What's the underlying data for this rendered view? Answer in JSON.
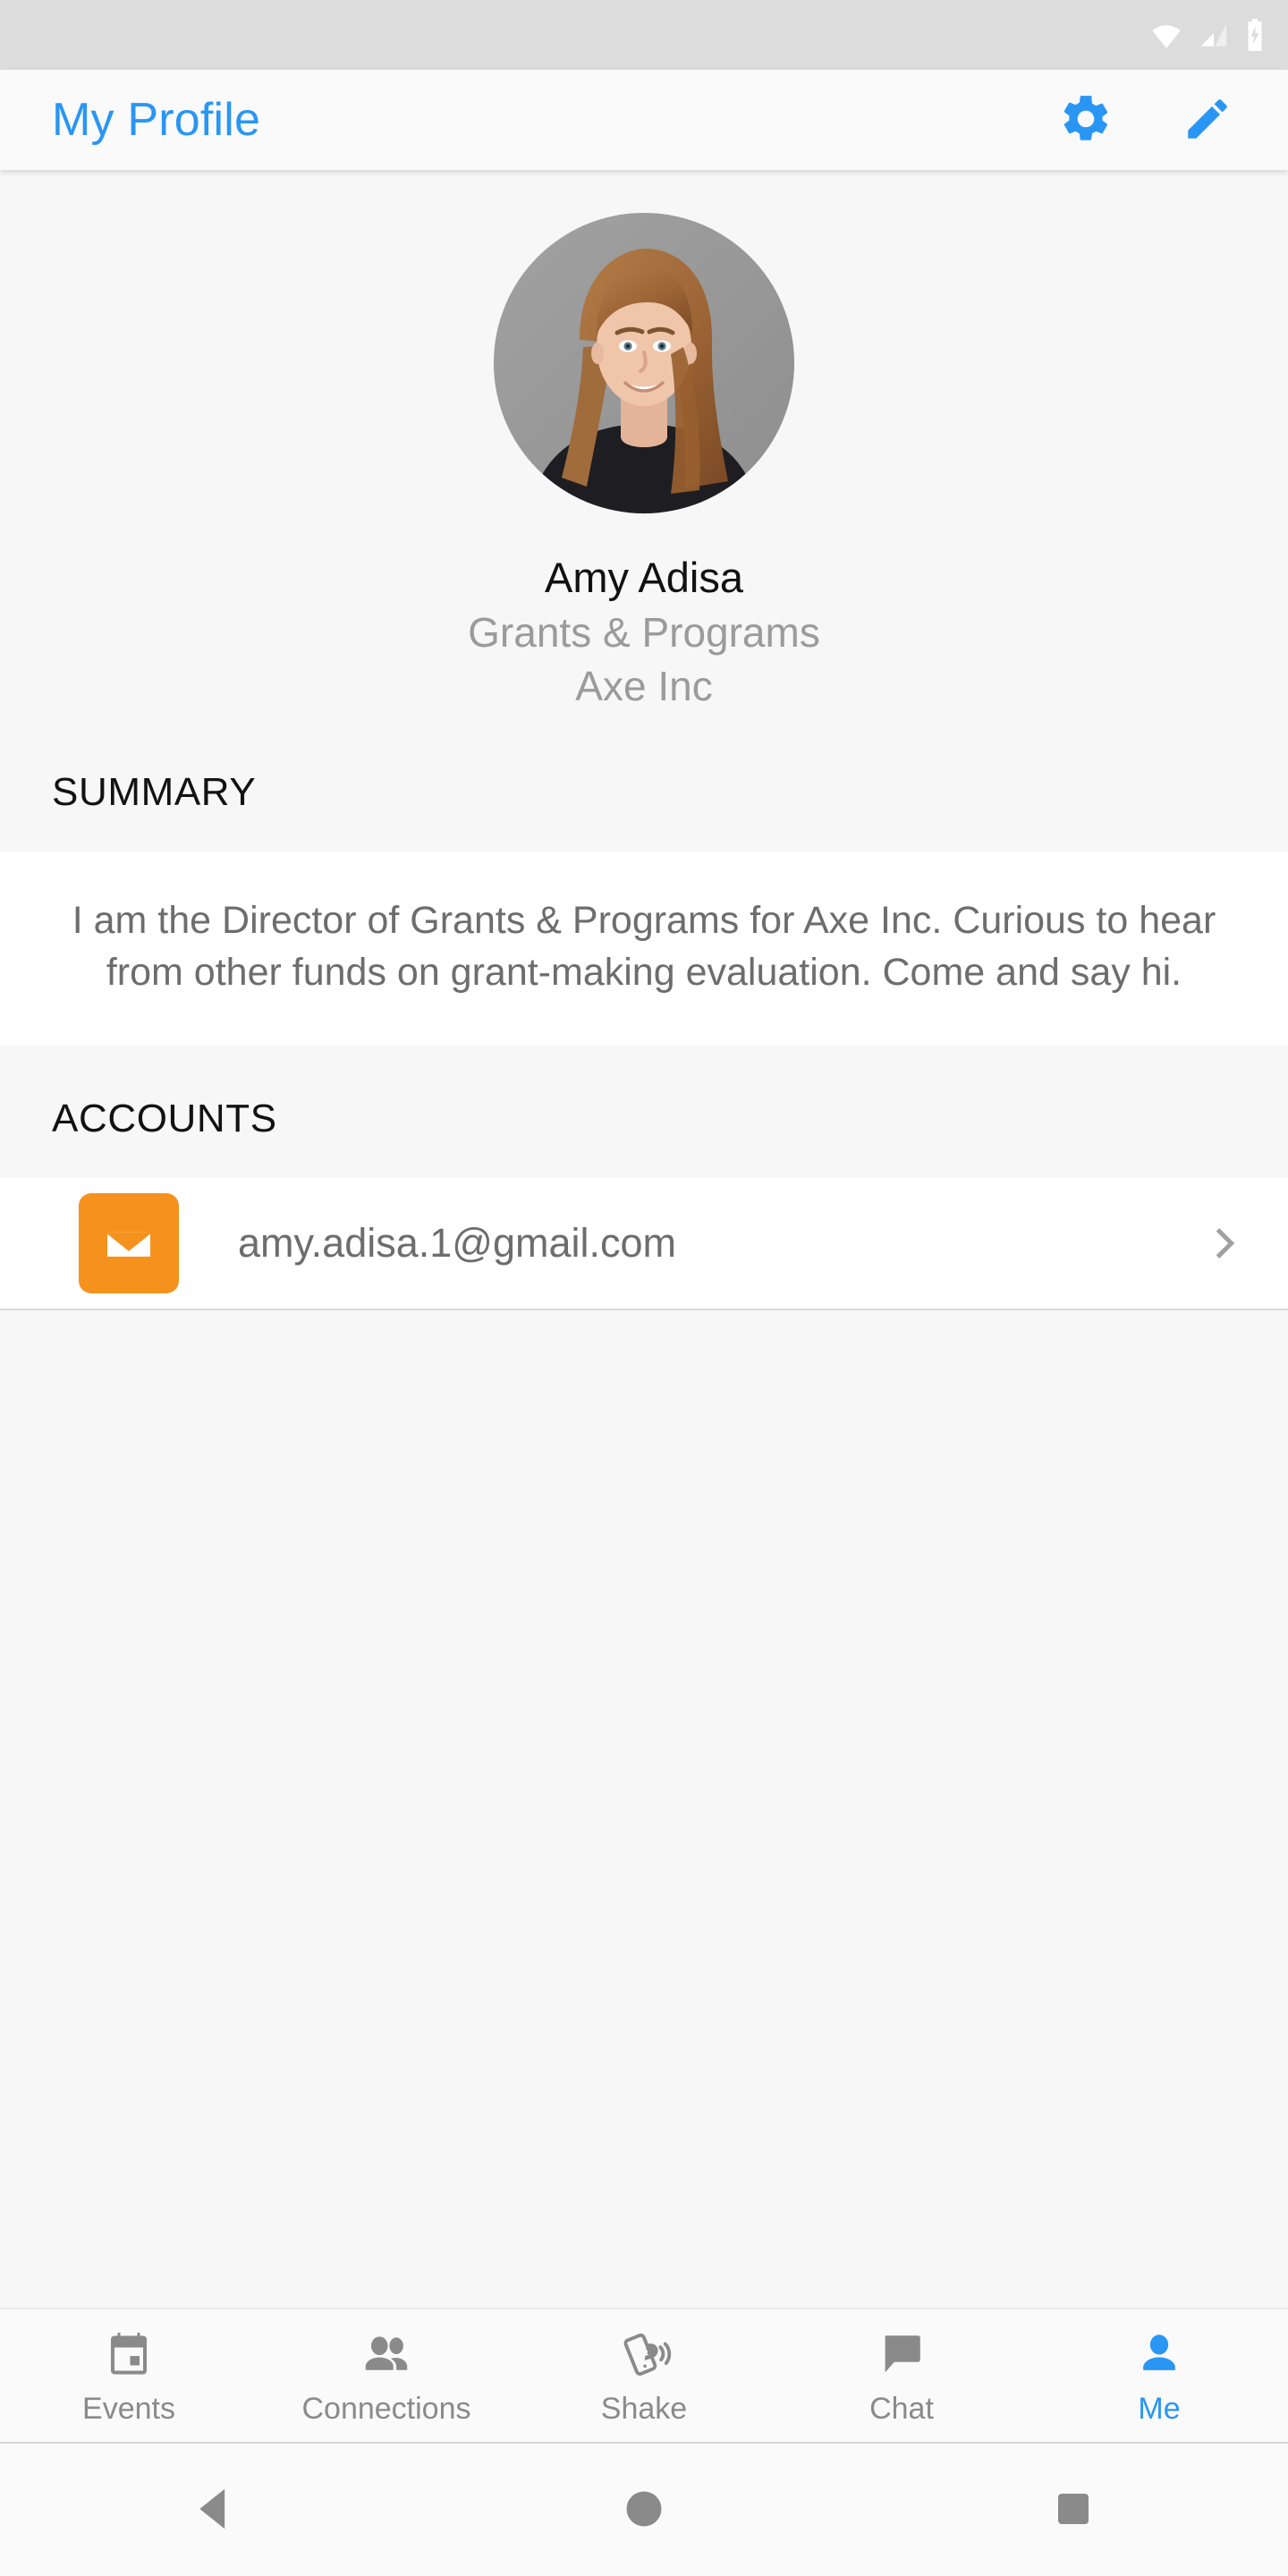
{
  "status_bar": {
    "icons": [
      "wifi-icon",
      "cellular-signal-icon",
      "battery-charging-icon"
    ]
  },
  "app_bar": {
    "title": "My Profile",
    "settings_label": "Settings",
    "edit_label": "Edit",
    "accent_color": "#2a96f3"
  },
  "profile": {
    "avatar_alt": "Amy Adisa profile photo",
    "name": "Amy Adisa",
    "role": "Grants & Programs",
    "company": "Axe Inc"
  },
  "summary": {
    "header": "SUMMARY",
    "text": "I am the Director of Grants & Programs for Axe Inc. Curious to hear from other funds on grant-making evaluation. Come and say hi."
  },
  "accounts": {
    "header": "ACCOUNTS",
    "items": [
      {
        "icon": "email-icon",
        "icon_color": "#f5921e",
        "value": "amy.adisa.1@gmail.com",
        "chevron": "chevron-right-icon"
      }
    ]
  },
  "tab_bar": {
    "active_color": "#2a96f3",
    "inactive_color": "#8a8a8a",
    "tabs": [
      {
        "label": "Events",
        "icon": "calendar-icon",
        "active": false
      },
      {
        "label": "Connections",
        "icon": "people-icon",
        "active": false
      },
      {
        "label": "Shake",
        "icon": "shake-phone-icon",
        "active": false
      },
      {
        "label": "Chat",
        "icon": "chat-bubble-icon",
        "active": false
      },
      {
        "label": "Me",
        "icon": "person-icon",
        "active": true
      }
    ]
  },
  "system_nav": {
    "back_label": "Back",
    "home_label": "Home",
    "recents_label": "Recents"
  }
}
